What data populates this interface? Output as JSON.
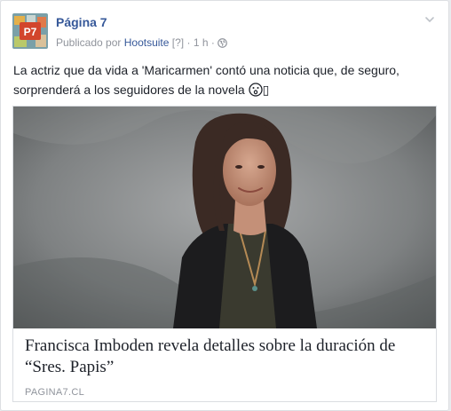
{
  "post": {
    "page_name": "Página 7",
    "meta": {
      "published_by": "Publicado por",
      "tool": "Hootsuite",
      "help": "[?]",
      "separator": "·",
      "time": "1 h",
      "separator2": "·",
      "audience_icon": "globe-icon"
    },
    "menu_icon": "chevron-down-icon",
    "avatar_text": "P7",
    "message": "La actriz que da vida a 'Maricarmen' contó una noticia que, de seguro, sorprenderá a los seguidores de la novela",
    "message_emoji": "face-with-open-mouth-icon",
    "message_trailing_char": "▯",
    "share": {
      "title": "Francisca Imboden revela detalles sobre la duración de “Sres. Papis”",
      "domain": "PAGINA7.CL"
    }
  },
  "colors": {
    "link": "#365899",
    "text": "#1d2129",
    "muted": "#90949c",
    "border": "#dddfe2"
  }
}
